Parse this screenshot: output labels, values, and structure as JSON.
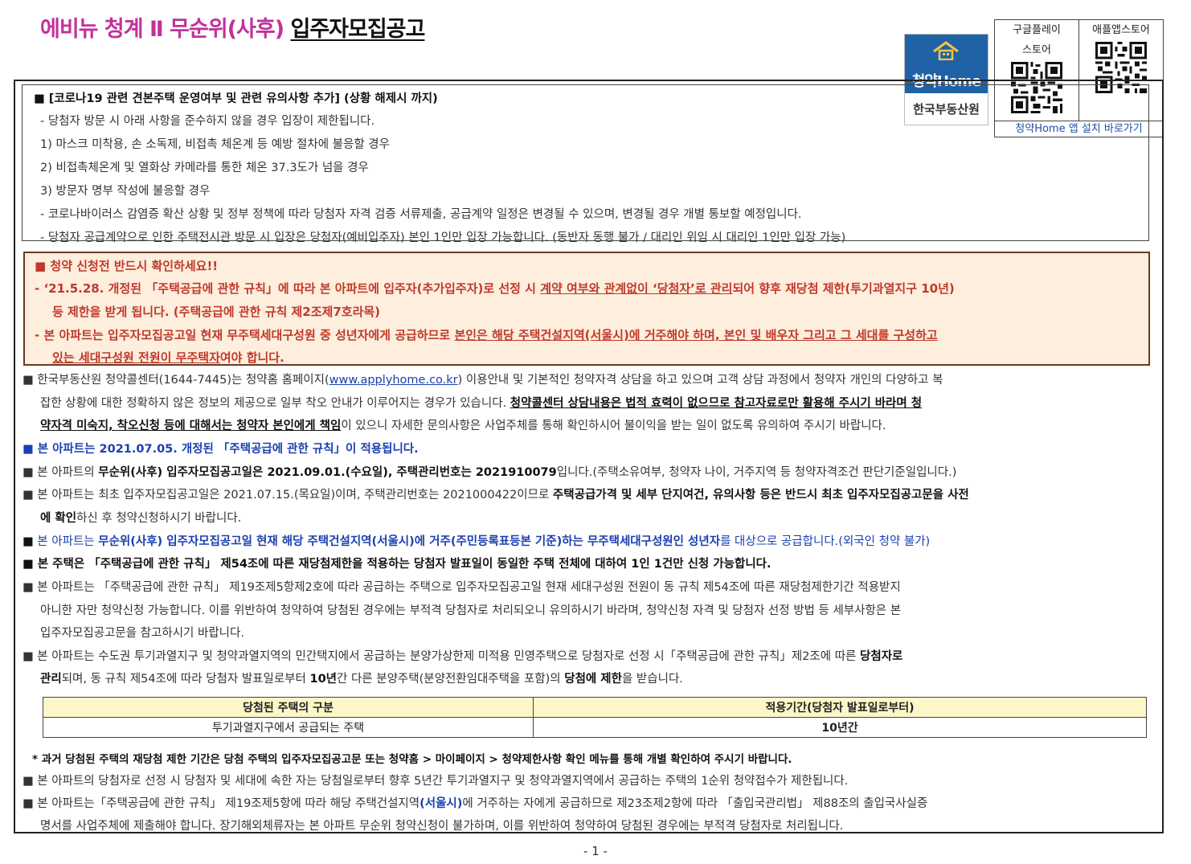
{
  "header": {
    "title_prefix": "에비뉴 청계 Ⅱ 무순위(사후)",
    "title_main": "입주자모집공고"
  },
  "logo": {
    "brand": "청약Home",
    "org": "한국부동산원"
  },
  "qr": {
    "google_label": "구글플레이 스토어",
    "apple_label": "애플앱스토어",
    "install_link": "청약Home 앱 설치 바로가기"
  },
  "covid": {
    "head": "■ [코로나19 관련 견본주택 운영여부 및 관련 유의사항 추가] (상황 해제시 까지)",
    "lines": [
      "- 당첨자 방문 시 아래 사항을 준수하지 않을 경우 입장이 제한됩니다.",
      "1) 마스크 미착용, 손 소독제, 비접촉 체온계 등 예방 절차에 불응할 경우",
      "2) 비접촉체온계 및 열화상 카메라를 통한 체온 37.3도가 넘을 경우",
      "3) 방문자 명부 작성에 불응할 경우",
      "- 코로나바이러스 감염증 확산 상황 및 정부 정책에 따라 당첨자 자격 검증 서류제출, 공급계약 일정은 변경될 수 있으며, 변경될 경우 개별 통보할 예정입니다.",
      "- 당첨자 공급계약으로 인한 주택전시관 방문 시 입장은 당첨자(예비입주자) 본인 1인만 입장 가능합니다. (동반자 동행 불가 / 대리인 위임 시 대리인 1인만 입장 가능)"
    ]
  },
  "notice": {
    "head": "■ 청약 신청전 반드시 확인하세요!!",
    "l1a": "- ‘21.5.28. 개정된 「주택공급에 관한 규칙」에 따라 본 아파트에 입주자(추가입주자)로 선정 시 ",
    "l1u": "계약 여부와 관계없이 ‘당첨자’로 관리",
    "l1b": "되어 향후 재당첨 제한(투기과열지구 10년)",
    "l2": "등 제한을 받게 됩니다. (주택공급에 관한 규칙 제2조제7호라목)",
    "l3a": "- 본 아파트는 입주자모집공고일 현재 무주택세대구성원 중 성년자에게 공급하므로 ",
    "l3u": "본인은 해당 주택건설지역(서울시)에 거주해야 하며, 본인 및 배우자 그리고 그 세대를 구성하고",
    "l4u": "있는 세대구성원 전원이 무주택자",
    "l4b": "여야 합니다."
  },
  "body": {
    "p1a": "■ 한국부동산원 청약콜센터(1644-7445)는 청약홈 홈페이지(",
    "p1link": "www.applyhome.co.kr",
    "p1b": ") 이용안내 및 기본적인 청약자격 상담을 하고 있으며 고객 상담 과정에서 청약자 개인의 다양하고 복",
    "p1c": "잡한 상황에 대한 정확하지 않은 정보의 제공으로 일부 착오 안내가 이루어지는 경우가 있습니다. ",
    "p1d": "청약콜센터 상담내용은 법적 효력이 없으므로 참고자료로만 활용해 주시기 바라며 청",
    "p1e": "약자격 미숙지, 착오신청 등에 대해서는 청약자 본인에게 책임",
    "p1f": "이 있으니 자세한 문의사항은 사업주체를 통해 확인하시어 불이익을 받는 일이 없도록 유의하여 주시기 바랍니다.",
    "p2": "■ 본 아파트는 2021.07.05. 개정된 「주택공급에 관한 규칙」이 적용됩니다.",
    "p3a": "■ 본 아파트의 ",
    "p3b": "무순위(사후) 입주자모집공고일은 2021.09.01.(수요일), 주택관리번호는 2021910079",
    "p3c": "입니다.(주택소유여부, 청약자 나이, 거주지역 등 청약자격조건 판단기준일입니다.)",
    "p4a": "■ 본 아파트는 최초 입주자모집공고일은 2021.07.15.(목요일)이며, 주택관리번호는 2021000422이므로 ",
    "p4b": "주택공급가격 및 세부 단지여건, 유의사항 등은 반드시 최초 입주자모집공고문을 사전",
    "p4c": "에 확인",
    "p4d": "하신 후 청약신청하시기 바랍니다.",
    "p5sq": "■",
    "p5a": " 본 아파트는 ",
    "p5b": "무순위(사후) 입주자모집공고일 현재 해당 주택건설지역(서울시)에 거주(주민등록표등본 기준)하는 무주택세대구성원인 성년자",
    "p5c": "를 대상으로 공급합니다.(외국인 청약 불가)",
    "p6": "■ 본 주택은 「주택공급에 관한 규칙」 제54조에 따른 재당첨제한을 적용하는 당첨자 발표일이 동일한 주택 전체에 대하여 1인 1건만 신청 가능합니다.",
    "p7a": "■ 본 아파트는 「주택공급에 관한 규칙」 제19조제5항제2호에 따라 공급하는 주택으로 입주자모집공고일 현재 세대구성원 전원이 동 규칙 제54조에 따른 재당첨제한기간 적용받지",
    "p7b": "아니한 자만 청약신청 가능합니다. 이를 위반하여 청약하여 당첨된 경우에는 부적격 당첨자로 처리되오니 유의하시기 바라며, 청약신청 자격 및 당첨자 선정 방법 등 세부사항은 본",
    "p7c": "입주자모집공고문을 참고하시기 바랍니다.",
    "p8a": "■ 본 아파트는 수도권 투기과열지구 및 청약과열지역의 민간택지에서 공급하는 분양가상한제 미적용 민영주택으로 당첨자로 선정 시「주택공급에 관한 규칙」제2조에 따른 ",
    "p8b": "당첨자로",
    "p8c": "관리",
    "p8d": "되며, 동 규칙 제54조에 따라 당첨자 발표일로부터 ",
    "p8e": "10년",
    "p8f": "간 다른 분양주택(분양전환임대주택을 포함)의 ",
    "p8g": "당첨에 제한",
    "p8h": "을 받습니다."
  },
  "table": {
    "headers": [
      "당첨된 주택의 구분",
      "적용기간(당첨자 발표일로부터)"
    ],
    "rows": [
      [
        "투기과열지구에서 공급되는 주택",
        "10년간"
      ]
    ]
  },
  "footer": {
    "note": "* 과거 당첨된 주택의 재당첨 제한 기간은 당첨 주택의 입주자모집공고문 또는 청약홈 > 마이페이지 > 청약제한사항 확인 메뉴를 통해 개별 확인하여 주시기 바랍니다.",
    "p9": "■ 본 아파트의 당첨자로 선정 시 당첨자 및 세대에 속한 자는 당첨일로부터 향후 5년간 투기과열지구 및 청약과열지역에서 공급하는 주택의 1순위 청약접수가 제한됩니다.",
    "p10a": "■ 본 아파트는「주택공급에 관한 규칙」 제19조제5항에 따라 해당 주택건설지역",
    "p10b": "(서울시)",
    "p10c": "에 거주하는 자에게 공급하므로 제23조제2항에 따라 「출입국관리법」 제88조의 출입국사실증",
    "p10d": "명서를 사업주체에 제출해야 합니다. 장기해외체류자는 본 아파트 무순위 청약신청이 불가하며, 이를 위반하여 청약하여 당첨된 경우에는 부적격 당첨자로 처리됩니다.",
    "page": "- 1 -"
  }
}
